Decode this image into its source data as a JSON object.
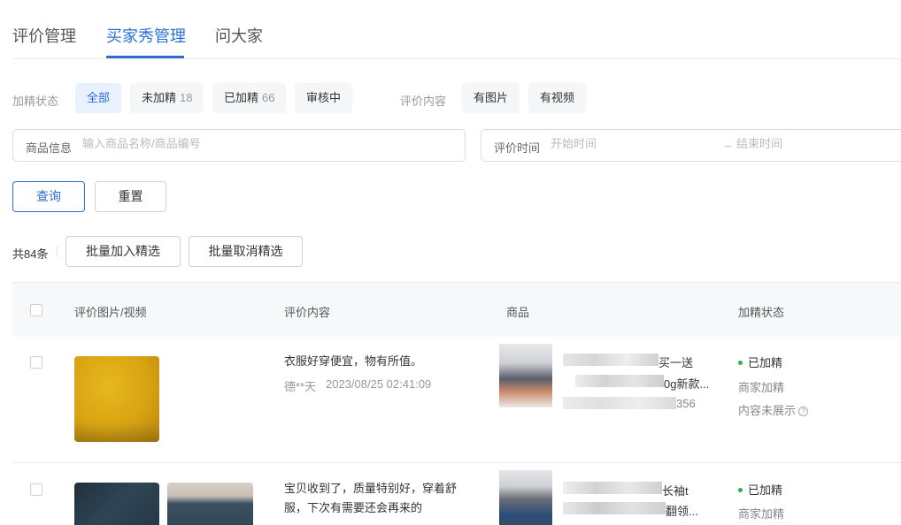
{
  "tabs": [
    {
      "label": "评价管理"
    },
    {
      "label": "买家秀管理"
    },
    {
      "label": "问大家"
    }
  ],
  "filters": {
    "status_label": "加精状态",
    "status_chips": [
      {
        "label": "全部",
        "count": ""
      },
      {
        "label": "未加精",
        "count": "18"
      },
      {
        "label": "已加精",
        "count": "66"
      },
      {
        "label": "审核中",
        "count": ""
      }
    ],
    "content_label": "评价内容",
    "content_chips": [
      {
        "label": "有图片"
      },
      {
        "label": "有视频"
      }
    ]
  },
  "search": {
    "product_label": "商品信息",
    "product_placeholder": "输入商品名称/商品编号",
    "time_label": "评价时间",
    "start_placeholder": "开始时间",
    "dash": "–",
    "end_placeholder": "结束时间"
  },
  "actions": {
    "query": "查询",
    "reset": "重置",
    "total": "共84条",
    "batch_add": "批量加入精选",
    "batch_cancel": "批量取消精选"
  },
  "table": {
    "headers": [
      "评价图片/视频",
      "评价内容",
      "商品",
      "加精状态"
    ],
    "rows": [
      {
        "content": "衣服好穿便宜，物有所值。",
        "user": "德**天",
        "time": "2023/08/25 02:41:09",
        "product_line1": "买一送",
        "product_line2": "0g新款...",
        "product_line3": "356",
        "status": "已加精",
        "source": "商家加精",
        "display": "内容未展示"
      },
      {
        "content": "宝贝收到了，质量特别好，穿着舒服，下次有需要还会再来的",
        "product_line1": "长袖t",
        "product_line2": "翻领...",
        "status": "已加精",
        "source": "商家加精"
      }
    ]
  },
  "colors": {
    "accent": "#2a6fd6",
    "status_green": "#2bb34a"
  }
}
